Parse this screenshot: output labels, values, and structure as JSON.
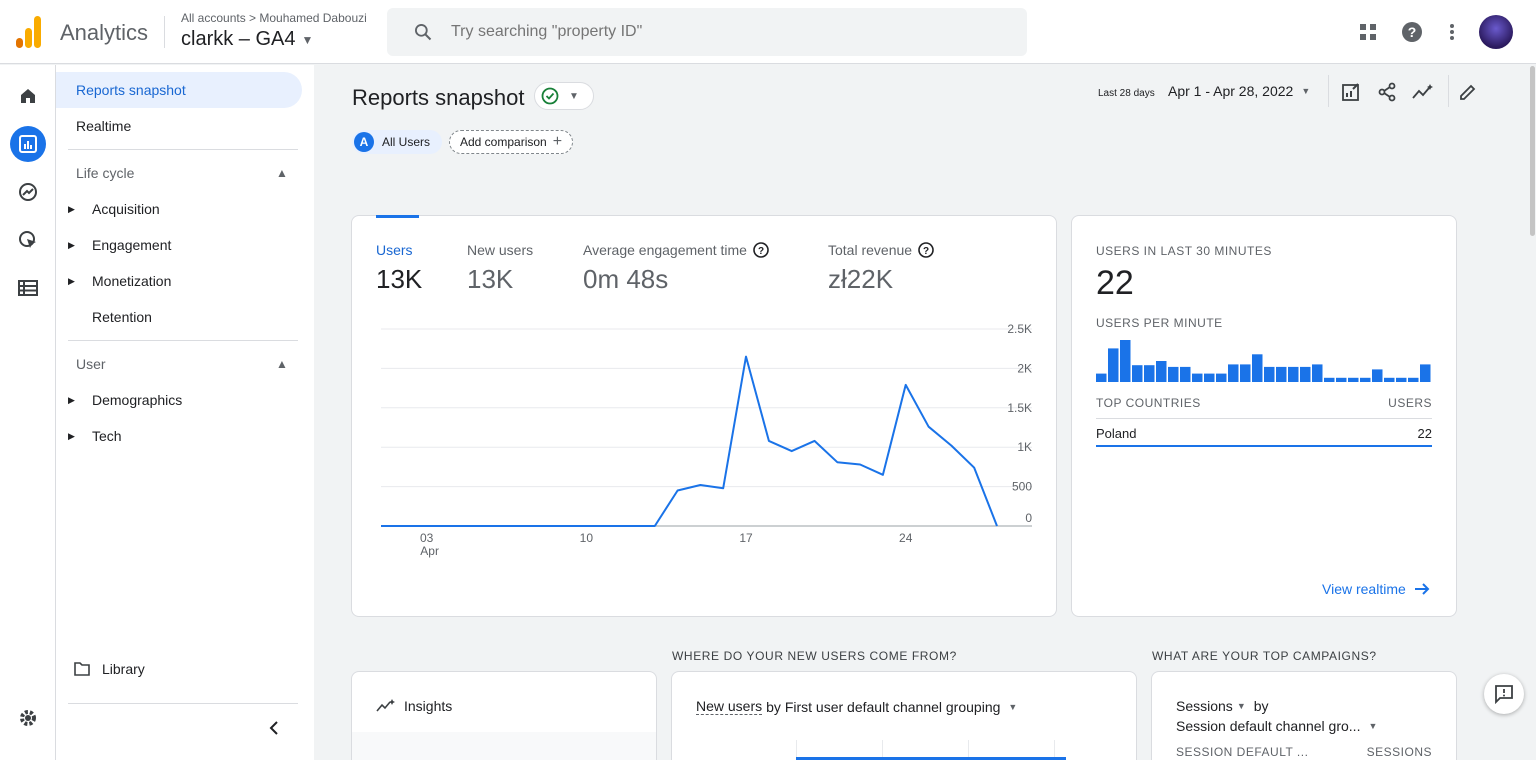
{
  "header": {
    "app_name": "Analytics",
    "breadcrumb_all": "All accounts",
    "breadcrumb_account": "Mouhamed Dabouzi",
    "property": "clarkk – GA4",
    "search_placeholder": "Try searching \"property ID\""
  },
  "nav": {
    "reports_snapshot": "Reports snapshot",
    "realtime": "Realtime",
    "lifecycle": "Life cycle",
    "acquisition": "Acquisition",
    "engagement": "Engagement",
    "monetization": "Monetization",
    "retention": "Retention",
    "user": "User",
    "demographics": "Demographics",
    "tech": "Tech",
    "library": "Library"
  },
  "page": {
    "title": "Reports snapshot",
    "all_users": "All Users",
    "all_users_badge": "A",
    "add_comparison": "Add comparison",
    "date_label": "Last 28 days",
    "date_range": "Apr 1 - Apr 28, 2022"
  },
  "metrics": [
    {
      "label": "Users",
      "value": "13K"
    },
    {
      "label": "New users",
      "value": "13K"
    },
    {
      "label": "Average engagement time",
      "value": "0m 48s"
    },
    {
      "label": "Total revenue",
      "value": "zł22K"
    }
  ],
  "realtime": {
    "title": "USERS IN LAST 30 MINUTES",
    "value": "22",
    "per_minute": "USERS PER MINUTE",
    "countries_hdr": "TOP COUNTRIES",
    "users_hdr": "USERS",
    "country": "Poland",
    "country_users": "22",
    "link": "View realtime"
  },
  "sections": {
    "new_users": "WHERE DO YOUR NEW USERS COME FROM?",
    "campaigns": "WHAT ARE YOUR TOP CAMPAIGNS?",
    "insights": "Insights",
    "new_users_metric": "New users",
    "new_users_dim": "by First user default channel grouping",
    "sessions": "Sessions",
    "by": "by",
    "session_dim": "Session default channel gro...",
    "col_session": "SESSION DEFAULT ...",
    "col_sessions": "SESSIONS"
  },
  "chart_data": [
    {
      "type": "line",
      "title": "",
      "x": [
        "Apr 1",
        "Apr 2",
        "Apr 3",
        "Apr 4",
        "Apr 5",
        "Apr 6",
        "Apr 7",
        "Apr 8",
        "Apr 9",
        "Apr 10",
        "Apr 11",
        "Apr 12",
        "Apr 13",
        "Apr 14",
        "Apr 15",
        "Apr 16",
        "Apr 17",
        "Apr 18",
        "Apr 19",
        "Apr 20",
        "Apr 21",
        "Apr 22",
        "Apr 23",
        "Apr 24",
        "Apr 25",
        "Apr 26",
        "Apr 27",
        "Apr 28"
      ],
      "series": [
        {
          "name": "Users",
          "values": [
            0,
            0,
            0,
            0,
            0,
            0,
            0,
            0,
            0,
            0,
            0,
            0,
            0,
            450,
            520,
            480,
            2150,
            1080,
            950,
            1080,
            810,
            780,
            650,
            1790,
            1260,
            1020,
            740,
            0
          ]
        }
      ],
      "x_tick_labels": [
        "03",
        "10",
        "17",
        "24"
      ],
      "x_tick_sublabel": "Apr",
      "y_tick_labels": [
        "0",
        "500",
        "1K",
        "1.5K",
        "2K",
        "2.5K"
      ],
      "ylim": [
        0,
        2500
      ],
      "color": "#1a73e8"
    },
    {
      "type": "bar",
      "title": "USERS PER MINUTE",
      "values": [
        1,
        4,
        5,
        2,
        2,
        2.5,
        1.8,
        1.8,
        1,
        1,
        1,
        2.1,
        2.1,
        3.3,
        1.8,
        1.8,
        1.8,
        1.8,
        2.1,
        0.5,
        0.5,
        0.5,
        0.5,
        1.5,
        0.5,
        0.5,
        0.5,
        2.1
      ],
      "color": "#1a73e8"
    }
  ],
  "colors": {
    "accent": "#1a73e8",
    "logo_orange": "#f9ab00",
    "logo_dark": "#e37400"
  }
}
